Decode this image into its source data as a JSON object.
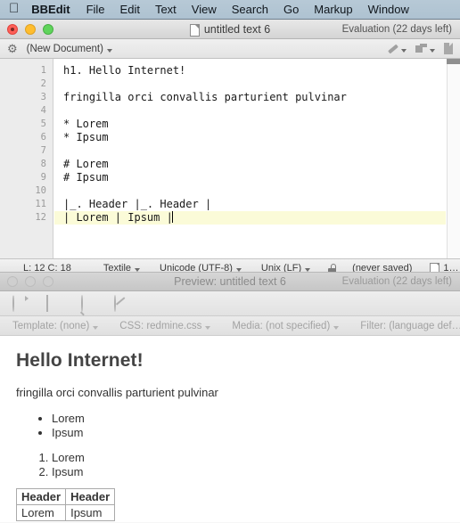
{
  "menubar": {
    "apple_icon": "apple-icon",
    "items": [
      {
        "label": "BBEdit",
        "bold": true
      },
      {
        "label": "File"
      },
      {
        "label": "Edit"
      },
      {
        "label": "Text"
      },
      {
        "label": "View"
      },
      {
        "label": "Search"
      },
      {
        "label": "Go"
      },
      {
        "label": "Markup"
      },
      {
        "label": "Window"
      }
    ]
  },
  "editor": {
    "title": "untitled text 6",
    "evaluation": "Evaluation (22 days left)",
    "toolbar": {
      "gear_icon": "gear-icon",
      "document_popup": "(New Document)",
      "pencil_icon": "pencil-icon",
      "stack_icon": "window-stack-icon",
      "page_icon": "page-icon"
    },
    "lines": [
      {
        "n": "1",
        "text": "h1. Hello Internet!"
      },
      {
        "n": "2",
        "text": ""
      },
      {
        "n": "3",
        "text": "fringilla orci convallis parturient pulvinar"
      },
      {
        "n": "4",
        "text": ""
      },
      {
        "n": "5",
        "text": "* Lorem"
      },
      {
        "n": "6",
        "text": "* Ipsum"
      },
      {
        "n": "7",
        "text": ""
      },
      {
        "n": "8",
        "text": "# Lorem"
      },
      {
        "n": "9",
        "text": "# Ipsum"
      },
      {
        "n": "10",
        "text": ""
      },
      {
        "n": "11",
        "text": "|_. Header |_. Header |"
      },
      {
        "n": "12",
        "text": "| Lorem | Ipsum |",
        "current": true
      }
    ],
    "statusbar": {
      "position": "L: 12 C: 18",
      "language": "Textile",
      "encoding": "Unicode (UTF-8)",
      "line_endings": "Unix (LF)",
      "lock_icon": "unlocked-padlock-icon",
      "saved_state": "(never saved)",
      "page_icon": "page-icon",
      "count": "1…"
    }
  },
  "preview": {
    "title": "Preview: untitled text 6",
    "evaluation": "Evaluation (22 days left)",
    "toolbar": {
      "reload_icon": "reload-icon",
      "document_icon": "document-icon",
      "search_icon": "search-icon",
      "browser_icon": "compass-icon"
    },
    "options": [
      {
        "label": "Template: (none)"
      },
      {
        "label": "CSS: redmine.css"
      },
      {
        "label": "Media: (not specified)"
      },
      {
        "label": "Filter: (language def…"
      }
    ],
    "content": {
      "heading": "Hello Internet!",
      "paragraph": "fringilla orci convallis parturient pulvinar",
      "bullets": [
        "Lorem",
        "Ipsum"
      ],
      "numbered": [
        "Lorem",
        "Ipsum"
      ],
      "table": {
        "headers": [
          "Header",
          "Header"
        ],
        "rows": [
          [
            "Lorem",
            "Ipsum"
          ]
        ]
      }
    }
  }
}
